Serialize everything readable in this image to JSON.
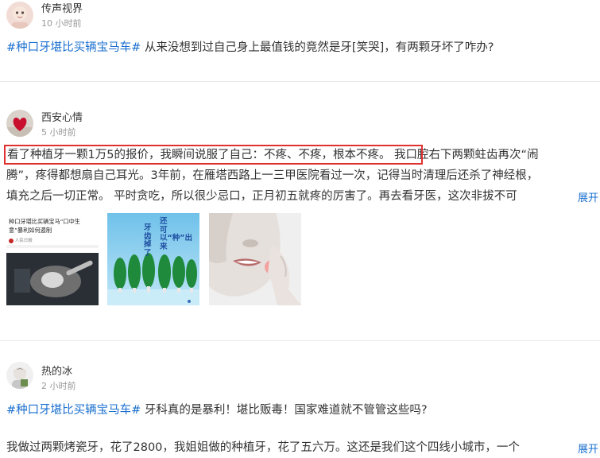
{
  "post1": {
    "username": "传声视界",
    "time": "10 小时前",
    "hashtag": "#种口牙堪比买辆宝马车#",
    "text": " 从来没想到过自己身上最值钱的竟然是牙[笑哭]，有两颗牙坏了咋办?"
  },
  "post2": {
    "username": "西安心情",
    "time": "5 小时前",
    "highlighted": "看了种植牙一颗1万5的报价，我瞬间说服了自己：不疼、不疼，根本不疼。",
    "line1_rest": " 我口腔右下两颗蛀齿再次“闹",
    "line2": "腾”，疼得都想扇自己耳光。3年前，在雁塔西路上一三甲医院看过一次，记得当时清理后还杀了神经根，",
    "line3": "填充之后一切正常。 平时贪吃，所以很少忌口，正月初五就疼的厉害了。再去看牙医，这次非拔不可",
    "expand": "展开",
    "image1": {
      "title_line1": "种口牙堪比买辆宝马“口中生",
      "title_line2": "意”暴利如何遏制",
      "source": "人民日报"
    },
    "image2": {
      "text_right": "还可以“种”出来",
      "text_left": "牙齿掉了"
    }
  },
  "post3": {
    "username": "热的冰",
    "time": "2 小时前",
    "hashtag": "#种口牙堪比买辆宝马车#",
    "text": " 牙科真的是暴利！堪比贩毒！国家难道就不管管这些吗?",
    "body": "我做过两颗烤瓷牙，花了2800，我姐姐做的种植牙，花了五六万。这还是我们这个四线小城市，一个",
    "expand": "展开"
  },
  "colors": {
    "link": "#1a6fcf",
    "highlight_border": "#e03131",
    "text": "#333333",
    "meta": "#999999"
  }
}
